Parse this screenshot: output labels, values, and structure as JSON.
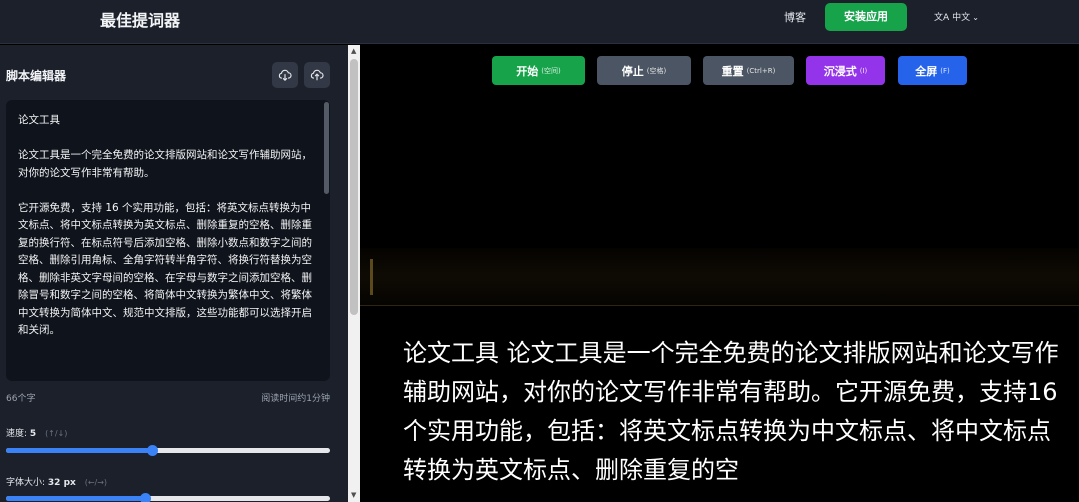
{
  "header": {
    "title": "最佳提词器",
    "blog": "博客",
    "install": "安装应用",
    "lang_icon": "translate-icon",
    "lang": "中文"
  },
  "sidebar": {
    "title": "脚本编辑器",
    "download_icon": "download-icon",
    "upload_icon": "upload-icon",
    "script": "论文工具\n\n论文工具是一个完全免费的论文排版网站和论文写作辅助网站，对你的论文写作非常有帮助。\n\n它开源免费，支持 16 个实用功能，包括：将英文标点转换为中文标点、将中文标点转换为英文标点、删除重复的空格、删除重复的换行符、在标点符号后添加空格、删除小数点和数字之间的空格、删除引用角标、全角字符转半角字符、将换行符替换为空格、删除非英文字母间的空格、在字母与数字之间添加空格、删除冒号和数字之间的空格、将简体中文转换为繁体中文、将繁体中文转换为简体中文、规范中文排版，这些功能都可以选择开启和关闭。",
    "char_count": "66个字",
    "read_time": "阅读时间约1分钟",
    "speed_label": "速度:",
    "speed_value": "5",
    "speed_hint": "(↑/↓)",
    "speed_fraction": 0.45,
    "font_label": "字体大小:",
    "font_value": "32 px",
    "font_hint": "(←/→)",
    "font_fraction": 0.43
  },
  "controls": {
    "start": "开始",
    "start_key": "(空间)",
    "stop": "停止",
    "stop_key": "(空格)",
    "reset": "重置",
    "reset_key": "(Ctrl+R)",
    "immersive": "沉浸式",
    "immersive_key": "(I)",
    "fullscreen": "全屏",
    "fullscreen_key": "(F)"
  },
  "prompter": {
    "text": "论文工具 论文工具是一个完全免费的论文排版网站和论文写作辅助网站，对你的论文写作非常有帮助。它开源免费，支持16个实用功能，包括：将英文标点转换为中文标点、将中文标点转换为英文标点、删除重复的空"
  },
  "colors": {
    "start": "#16a34a",
    "stop": "#4b5563",
    "reset": "#4b5563",
    "immersive": "#9333ea",
    "fullscreen": "#2563eb",
    "slider": "#3b82f6"
  }
}
